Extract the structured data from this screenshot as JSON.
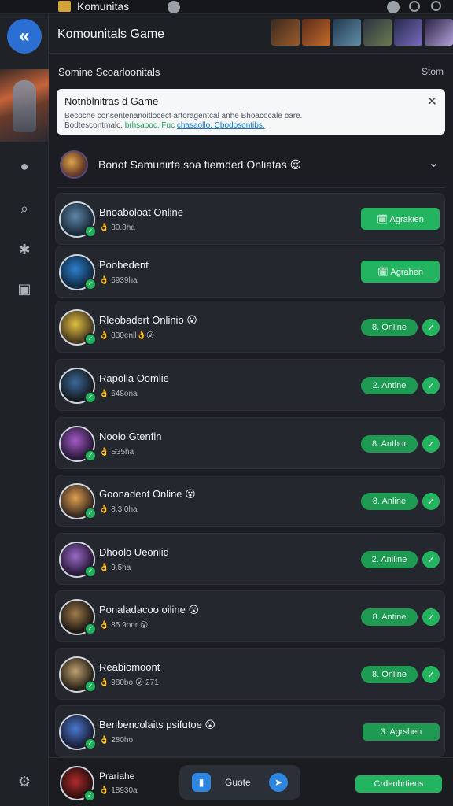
{
  "window": {
    "title": "Komunitas"
  },
  "header": {
    "title": "Komounitals Game"
  },
  "section": {
    "title": "Somine Scoarloonitals",
    "more": "Stom"
  },
  "notice": {
    "title": "Notnblnitras d Game",
    "line1": "Becoche consentenanoitlocect artoragentcal anhe Bhoacocale bare.",
    "line2_a": "Bodtescontmalc, ",
    "line2_b": "brhsaooc,",
    "line2_c": " Fuc ",
    "line2_d": "chasaollo, Cbodosontibs."
  },
  "group": {
    "title": "Bonot Samunirta soa fiemded Onliatas 😌"
  },
  "friends": [
    {
      "name": "Bnoaboloat Online",
      "meta": "👌 80.8ha",
      "action": "button",
      "label": "🗓 Agrakien"
    },
    {
      "name": "Poobedent",
      "meta": "👌 6939ha",
      "action": "button",
      "label": "🗓 Agrahen"
    },
    {
      "name": "Rleobadert Onlinio 😮",
      "meta": "👌 830enil👌😮",
      "action": "pill",
      "label": "8. Online"
    },
    {
      "name": "Rapolia Oomlie",
      "meta": "👌 648ona",
      "action": "pill",
      "label": "2. Antine"
    },
    {
      "name": "Nooio Gtenfin",
      "meta": "👌 S35ha",
      "action": "pill",
      "label": "8. Anthor"
    },
    {
      "name": "Goonadent Online 😮",
      "meta": "👌 8.3.0ha",
      "action": "pill",
      "label": "8. Anline"
    },
    {
      "name": "Dhoolo Ueonlid",
      "meta": "👌 9.5ha",
      "action": "pill",
      "label": "2. Aniline"
    },
    {
      "name": "Ponaladacoo oiline 😮",
      "meta": "👌 85.9onr 😮",
      "action": "pill",
      "label": "8. Antine"
    },
    {
      "name": "Reabiomoont",
      "meta": "👌 980bo 😮 271",
      "action": "pill",
      "label": "8. Online"
    },
    {
      "name": "Benbencolaits psifutoe 😮",
      "meta": "👌 280ho",
      "action": "wide",
      "label": "3. Agrshen"
    }
  ],
  "me": {
    "name": "Prariahe",
    "meta": "👌 18930a"
  },
  "dock": {
    "label": "Guote"
  },
  "bottom_button": "Crdenbrtiens",
  "icons": {
    "back": "double-chevron-left-icon",
    "close": "close-icon",
    "chevron": "chevron-down-icon",
    "check": "check-icon"
  }
}
